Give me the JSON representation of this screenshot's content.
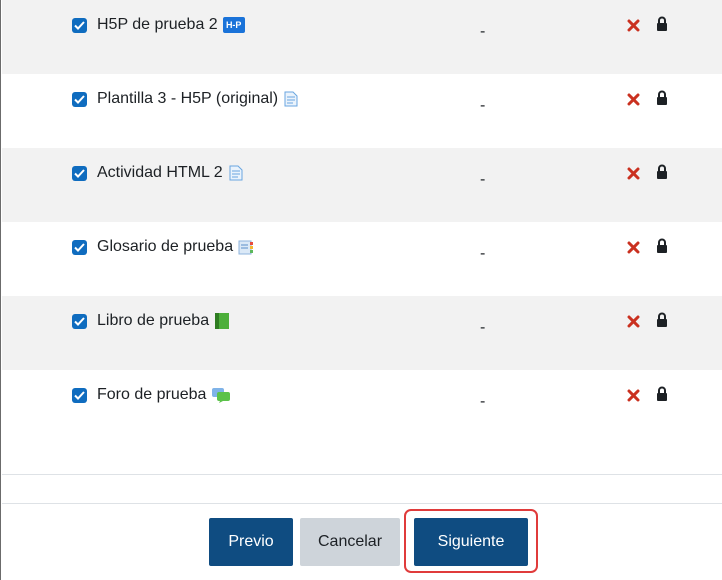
{
  "activities": [
    {
      "name": "H5P de prueba 2",
      "value": "-",
      "icon": "h5p-icon",
      "checked": true
    },
    {
      "name": "Plantilla 3 - H5P (original)",
      "value": "-",
      "icon": "page-icon",
      "checked": true
    },
    {
      "name": "Actividad HTML 2",
      "value": "-",
      "icon": "page-icon",
      "checked": true
    },
    {
      "name": "Glosario de prueba",
      "value": "-",
      "icon": "glossary-icon",
      "checked": true
    },
    {
      "name": "Libro de prueba",
      "value": "-",
      "icon": "book-icon",
      "checked": true
    },
    {
      "name": "Foro de prueba",
      "value": "-",
      "icon": "forum-icon",
      "checked": true
    }
  ],
  "icon_text": {
    "h5p": "H-P"
  },
  "buttons": {
    "previous": "Previo",
    "cancel": "Cancelar",
    "next": "Siguiente"
  },
  "colors": {
    "primary": "#0f4c81",
    "checkbox": "#0f6cbf",
    "remove": "#ca3120",
    "highlight": "#e03b3b"
  }
}
